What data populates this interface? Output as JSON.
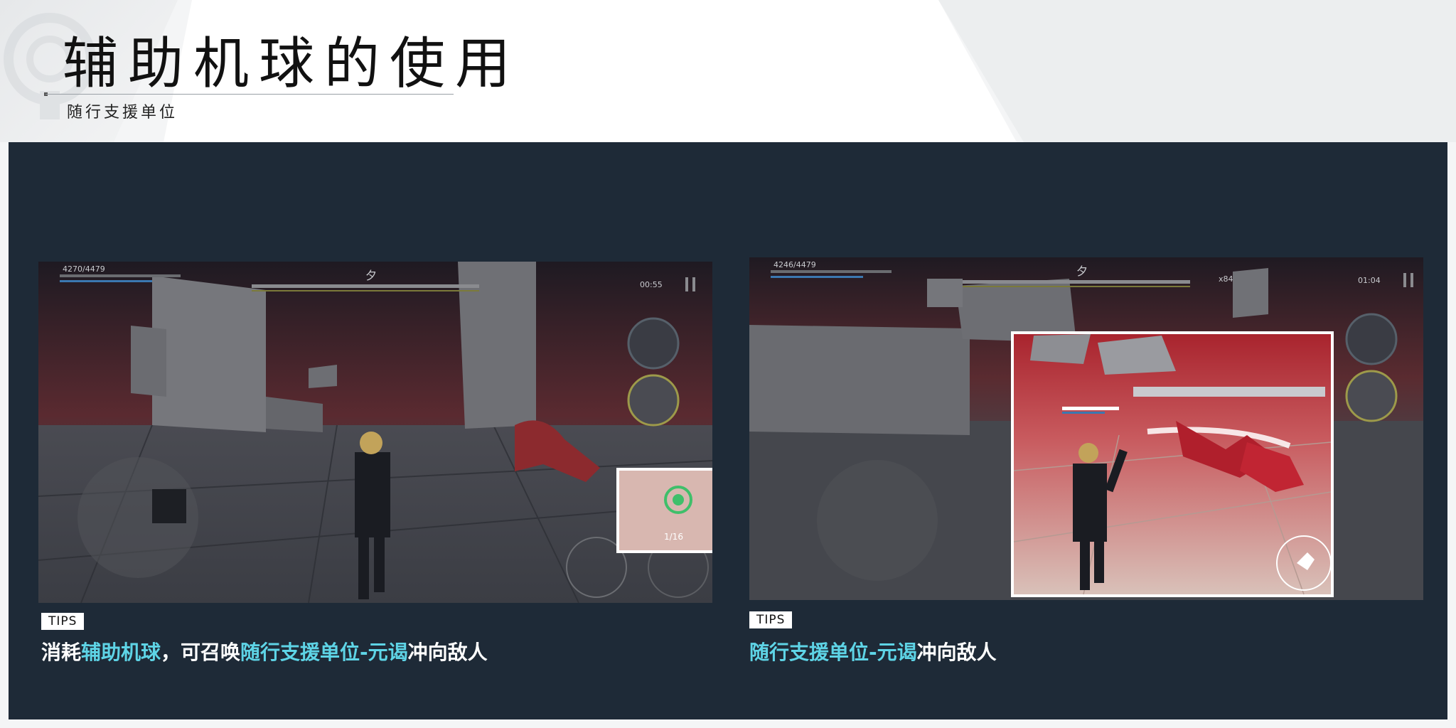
{
  "header": {
    "title": "辅助机球的使用",
    "subtitle": "随行支援单位"
  },
  "left_panel": {
    "hud": {
      "hp": "4270/4479",
      "boss_name": "夕",
      "timer": "00:55",
      "skill_count": "1/16"
    },
    "tips_label": "TIPS",
    "caption": {
      "part1": "消耗",
      "part2": "辅助机球",
      "part3": "，可召唤",
      "part4": "随行支援单位-元谒",
      "part5": "冲向敌人"
    }
  },
  "right_panel": {
    "hud": {
      "hp": "4246/4479",
      "boss_name": "夕",
      "timer": "01:04",
      "multiplier": "x84"
    },
    "tips_label": "TIPS",
    "caption": {
      "part1": "随行支援单位-元谒",
      "part2": "冲向敌人"
    }
  },
  "colors": {
    "panel_bg": "#1e2a37",
    "highlight": "#5ed4e6",
    "accent_red": "#b3262e"
  }
}
